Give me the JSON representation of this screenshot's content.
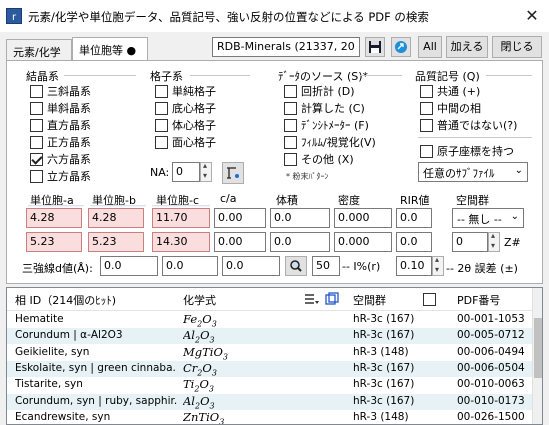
{
  "window": {
    "title": "元素/化学や単位胞データ、品質記号、強い反射の位置などによる PDF の検索",
    "close": "✕"
  },
  "tabs": [
    {
      "label": "元素/化学"
    },
    {
      "label": "単位胞等 ●"
    }
  ],
  "toolbar": {
    "database": "RDB-Minerals (21337, 20",
    "all_label": "All",
    "add_label": "加える",
    "close_label": "閉じる"
  },
  "crystal_system": {
    "title": "結晶系",
    "items": [
      {
        "label": "三斜晶系",
        "checked": false
      },
      {
        "label": "単斜晶系",
        "checked": false
      },
      {
        "label": "直方晶系",
        "checked": false
      },
      {
        "label": "正方晶系",
        "checked": false
      },
      {
        "label": "六方晶系",
        "checked": true
      },
      {
        "label": "立方晶系",
        "checked": false
      }
    ]
  },
  "lattice": {
    "title": "格子系",
    "items": [
      {
        "label": "単純格子",
        "checked": false
      },
      {
        "label": "底心格子",
        "checked": false
      },
      {
        "label": "体心格子",
        "checked": false
      },
      {
        "label": "面心格子",
        "checked": false
      }
    ],
    "na_label": "NA:",
    "na_value": "0"
  },
  "data_source": {
    "title": "ﾃﾞｰﾀのソース (S)*",
    "items": [
      {
        "label": "回折計 (D)",
        "checked": false
      },
      {
        "label": "計算した (C)",
        "checked": false
      },
      {
        "label": "ﾃﾞﾝｼﾄﾒｰﾀｰ (F)",
        "checked": false
      },
      {
        "label": "ﾌｨﾙﾑ/視覚化(V)",
        "checked": false
      },
      {
        "label": "その他 (X)",
        "checked": false
      }
    ],
    "note": "* 粉末ﾊﾟﾀｰﾝ"
  },
  "quality": {
    "title": "品質記号 (Q)",
    "items": [
      {
        "label": "共通 (+)",
        "checked": false
      },
      {
        "label": "中間の相",
        "checked": false
      },
      {
        "label": "普通ではない(?)",
        "checked": false
      }
    ],
    "atom_coords": {
      "label": "原子座標を持つ",
      "checked": false
    },
    "subfile": "任意のｻﾌﾞﾌｧｲﾙ"
  },
  "cell_params": {
    "headers": [
      "単位胞-a",
      "単位胞-b",
      "単位胞-c",
      "c/a",
      "体積",
      "密度",
      "RIR値",
      "空間群"
    ],
    "min": [
      "4.28",
      "4.28",
      "11.70",
      "0.00",
      "0.0",
      "0.000",
      "0.0"
    ],
    "max": [
      "5.23",
      "5.23",
      "14.30",
      "0.00",
      "0.0",
      "0.000",
      "0.0"
    ],
    "space_group": "-- 無し --",
    "z_value": "0",
    "z_label": "Z#"
  },
  "d_spacing": {
    "label": "三強線d値(Å):",
    "d1": "0.0",
    "d2": "0.0",
    "d3": "0.0",
    "intensity": "50",
    "intensity_label": "-- I%(r)",
    "error": "0.10",
    "error_label": "-- 2θ 誤差 (±)"
  },
  "results": {
    "columns": {
      "name": "相 ID（214個のﾋｯﾄ)",
      "formula": "化学式",
      "space_group": "空間群",
      "pdf": "PDF番号"
    },
    "rows": [
      {
        "name": "Hematite",
        "formula": [
          [
            "Fe",
            "2"
          ],
          [
            "O",
            "3"
          ]
        ],
        "sg": "hR-3c (167)",
        "pdf": "00-001-1053"
      },
      {
        "name": "Corundum | α-Al2O3",
        "formula": [
          [
            "Al",
            "2"
          ],
          [
            "O",
            "3"
          ]
        ],
        "sg": "hR-3c (167)",
        "pdf": "00-005-0712"
      },
      {
        "name": "Geikielite, syn",
        "formula": [
          [
            "MgTiO",
            "3"
          ]
        ],
        "sg": "hR-3 (148)",
        "pdf": "00-006-0494"
      },
      {
        "name": "Eskolaite, syn | green cinnaba...",
        "formula": [
          [
            "Cr",
            "2"
          ],
          [
            "O",
            "3"
          ]
        ],
        "sg": "hR-3c (167)",
        "pdf": "00-006-0504"
      },
      {
        "name": "Tistarite, syn",
        "formula": [
          [
            "Ti",
            "2"
          ],
          [
            "O",
            "3"
          ]
        ],
        "sg": "hR-3c (167)",
        "pdf": "00-010-0063"
      },
      {
        "name": "Corundum, syn | ruby, sapphir...",
        "formula": [
          [
            "Al",
            "2"
          ],
          [
            "O",
            "3"
          ]
        ],
        "sg": "hR-3c (167)",
        "pdf": "00-010-0173"
      },
      {
        "name": "Ecandrewsite, syn",
        "formula": [
          [
            "ZnTiO",
            "3"
          ]
        ],
        "sg": "hR-3 (148)",
        "pdf": "00-026-1500"
      }
    ]
  }
}
